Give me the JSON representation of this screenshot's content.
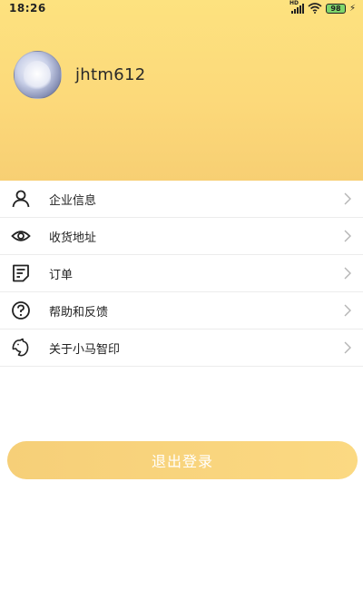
{
  "status_bar": {
    "time": "18:26",
    "network": "HD",
    "battery": "98"
  },
  "profile": {
    "username": "jhtm612"
  },
  "menu": {
    "items": [
      {
        "label": "企业信息",
        "icon": "person-icon"
      },
      {
        "label": "收货地址",
        "icon": "eye-icon"
      },
      {
        "label": "订单",
        "icon": "order-list-icon"
      },
      {
        "label": "帮助和反馈",
        "icon": "help-circle-icon"
      },
      {
        "label": "关于小马智印",
        "icon": "horse-logo-icon"
      }
    ]
  },
  "logout": {
    "label": "退出登录"
  },
  "colors": {
    "header_top": "#fde27f",
    "header_bottom": "#f7cf73",
    "logout_button": "#f8d47d"
  }
}
